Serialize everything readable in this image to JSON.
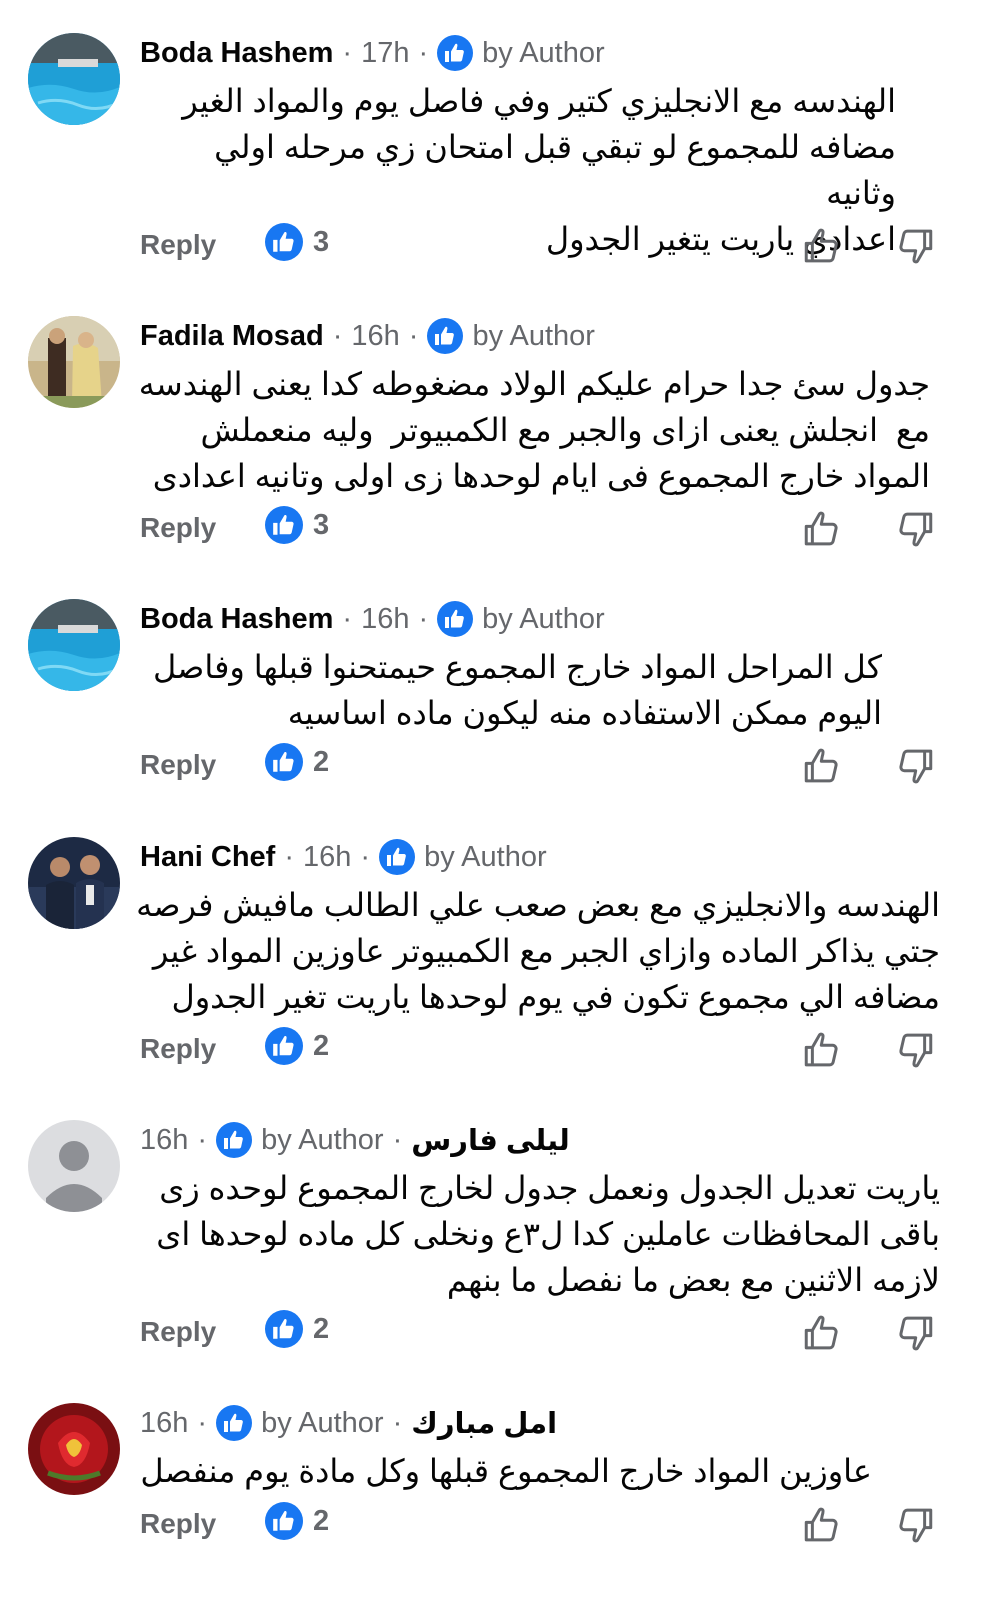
{
  "comments": [
    {
      "name": "Boda Hashem",
      "time": "17h",
      "author_label": "by Author",
      "text": "الهندسه مع الانجليزي كتير وفي فاصل يوم والمواد الغير\nمضافه للمجموع لو تبقي قبل امتحان زي مرحله اولي وثانيه\nاعدادي ياريت يتغير الجدول",
      "reply_label": "Reply",
      "likes": "3"
    },
    {
      "name": "Fadila Mosad",
      "time": "16h",
      "author_label": "by Author",
      "text": "جدول سئ جدا حرام عليكم الولاد مضغوطه كدا يعنى الهندسه\nمع  انجلش يعنى ازاى والجبر مع الكمبيوتر  وليه منعملش\nالمواد خارج المجموع فى ايام لوحدها زى اولى وتانيه اعدادى",
      "reply_label": "Reply",
      "likes": "3"
    },
    {
      "name": "Boda Hashem",
      "time": "16h",
      "author_label": "by Author",
      "text": "كل المراحل المواد خارج المجموع حيمتحنوا قبلها وفاصل\nاليوم ممكن الاستفاده منه ليكون ماده اساسيه",
      "reply_label": "Reply",
      "likes": "2"
    },
    {
      "name": "Hani Chef",
      "time": "16h",
      "author_label": "by Author",
      "text": "الهندسه والانجليزي مع بعض صعب علي الطالب مافيش فرصه\nجتي يذاكر الماده وازاي الجبر مع الكمبيوتر عاوزين المواد غير\nمضافه الي مجموع تكون في يوم لوحدها ياريت تغير الجدول",
      "reply_label": "Reply",
      "likes": "2"
    },
    {
      "name": "ليلى  فارس",
      "time": "16h",
      "author_label": "by Author",
      "text": "ياريت تعديل الجدول ونعمل جدول لخارج المجموع لوحده زى\nباقى المحافظات عاملين كدا ل٣ع ونخلى كل ماده لوحدها اى\nلازمه الاثنين مع بعض ما نفصل ما بنهم",
      "reply_label": "Reply",
      "likes": "2"
    },
    {
      "name": "امل  مبارك",
      "time": "16h",
      "author_label": "by Author",
      "text": "عاوزين المواد خارج المجموع قبلها وكل مادة يوم منفصل",
      "reply_label": "Reply",
      "likes": "2"
    }
  ],
  "icons": {
    "author_badge": "thumbs-up-icon",
    "like_badge": "thumbs-up-icon",
    "like_action": "thumb-up-outline-icon",
    "dislike_action": "thumb-down-outline-icon"
  },
  "colors": {
    "accent": "#1877f2",
    "secondary_text": "#65676b",
    "text": "#050505"
  }
}
